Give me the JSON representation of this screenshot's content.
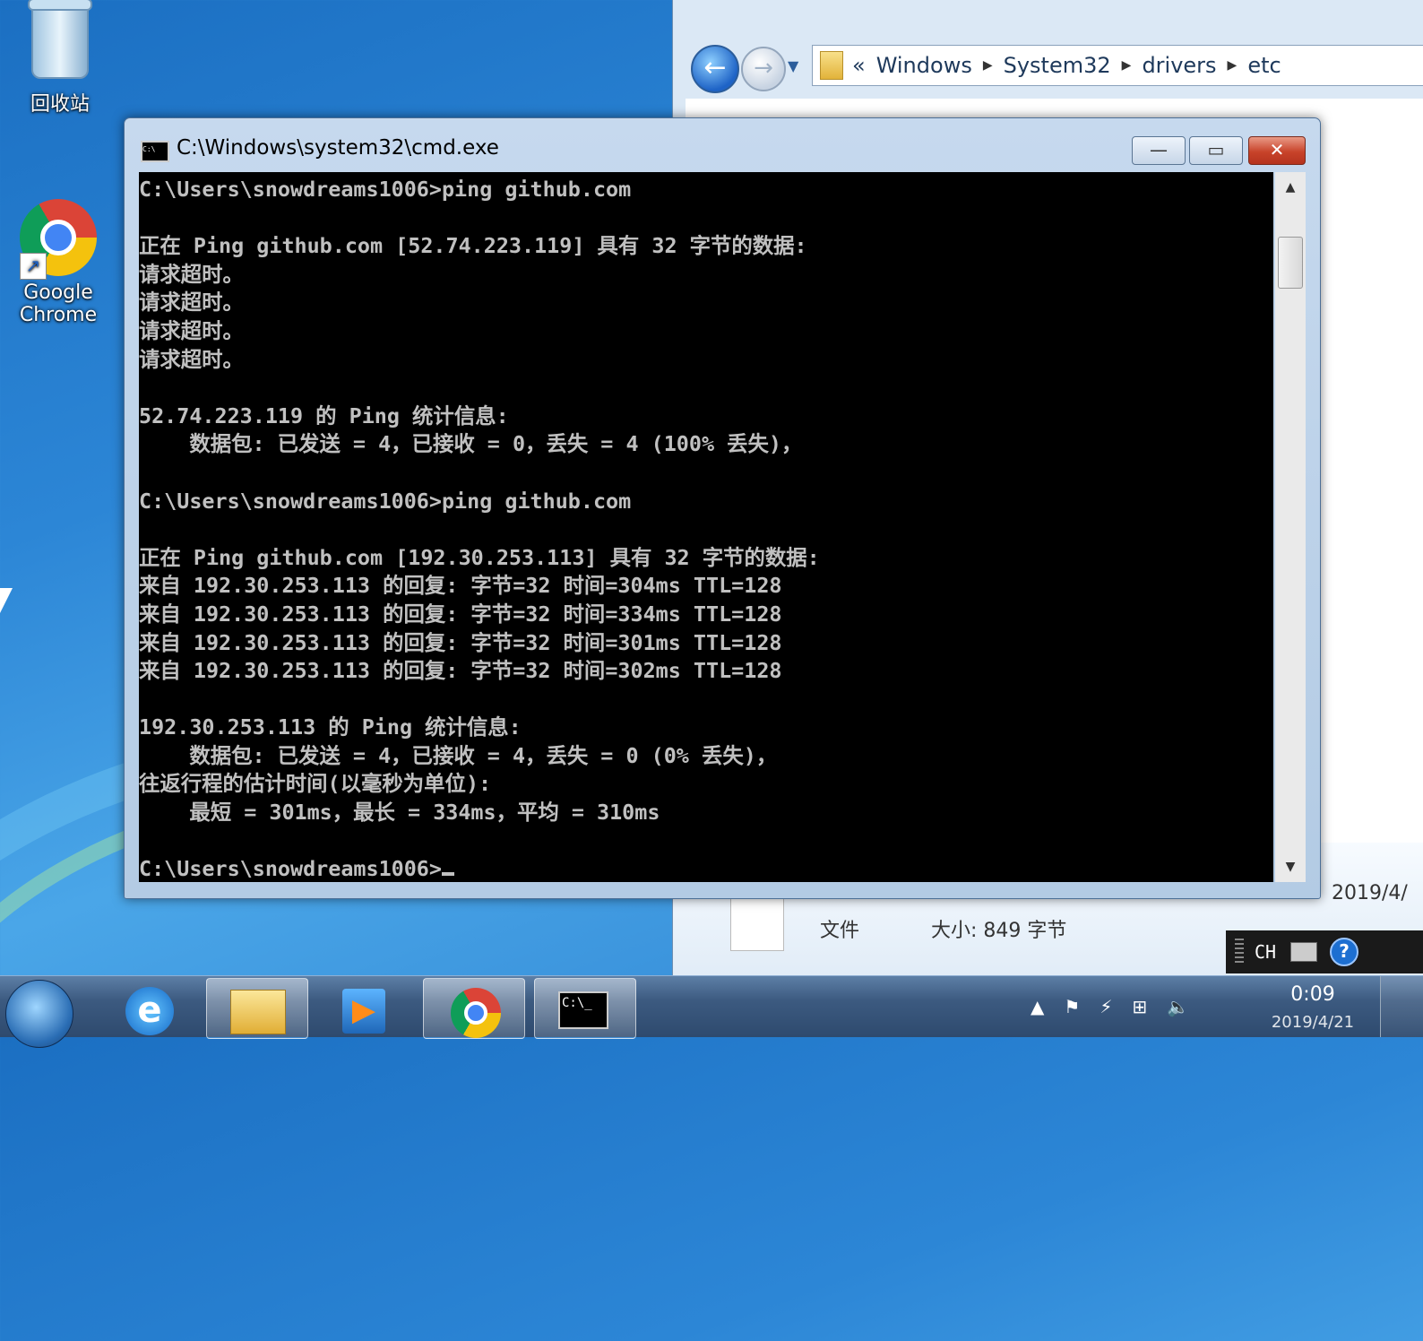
{
  "desktop": {
    "recycle_bin_label": "回收站",
    "chrome_label_line1": "Google",
    "chrome_label_line2": "Chrome"
  },
  "explorer": {
    "breadcrumb_prefix": "«",
    "breadcrumb": [
      "Windows",
      "System32",
      "drivers",
      "etc"
    ],
    "details_type": "文件",
    "details_size": "大小: 849 字节",
    "details_date": "2019/4/"
  },
  "cmd": {
    "title": "C:\\Windows\\system32\\cmd.exe",
    "min_label": "—",
    "max_label": "▭",
    "close_label": "✕",
    "output": "C:\\Users\\snowdreams1006>ping github.com\n\n正在 Ping github.com [52.74.223.119] 具有 32 字节的数据:\n请求超时。\n请求超时。\n请求超时。\n请求超时。\n\n52.74.223.119 的 Ping 统计信息:\n    数据包: 已发送 = 4，已接收 = 0，丢失 = 4 (100% 丢失)，\n\nC:\\Users\\snowdreams1006>ping github.com\n\n正在 Ping github.com [192.30.253.113] 具有 32 字节的数据:\n来自 192.30.253.113 的回复: 字节=32 时间=304ms TTL=128\n来自 192.30.253.113 的回复: 字节=32 时间=334ms TTL=128\n来自 192.30.253.113 的回复: 字节=32 时间=301ms TTL=128\n来自 192.30.253.113 的回复: 字节=32 时间=302ms TTL=128\n\n192.30.253.113 的 Ping 统计信息:\n    数据包: 已发送 = 4，已接收 = 4，丢失 = 0 (0% 丢失)，\n往返行程的估计时间(以毫秒为单位):\n    最短 = 301ms，最长 = 334ms，平均 = 310ms\n\nC:\\Users\\snowdreams1006>"
  },
  "langbar": {
    "lang": "CH",
    "help": "?"
  },
  "taskbar": {
    "cmd_icon_text": "C:\\_",
    "clock_time": "0:09",
    "clock_date": "2019/4/21"
  }
}
